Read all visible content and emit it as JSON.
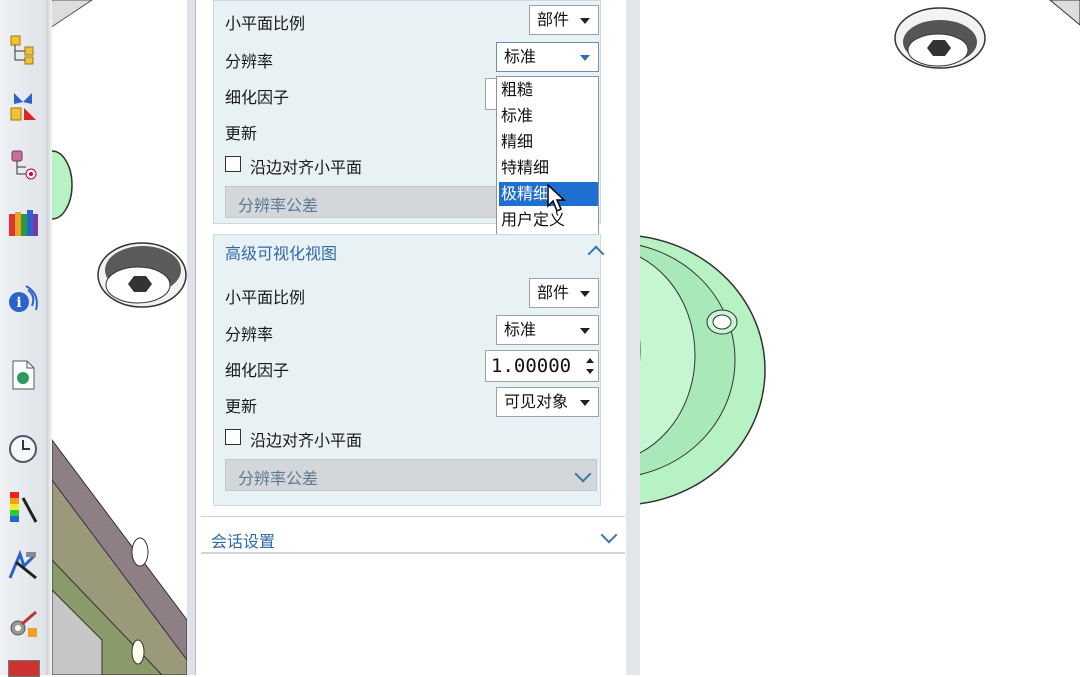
{
  "toolbar": {
    "icons": [
      "assembly-navigator-icon",
      "constraint-icon",
      "part-navigator-icon",
      "reuse-library-icon",
      "info-icon",
      "document-icon",
      "history-icon",
      "analysis-icon",
      "roles-icon",
      "process-icon"
    ]
  },
  "panel1": {
    "facet_label": "小平面比例",
    "facet_value": "部件",
    "resolution_label": "分辨率",
    "resolution_value": "标准",
    "refine_label": "细化因子",
    "update_label": "更新",
    "edge_align_label": "沿边对齐小平面",
    "tolerance_label": "分辨率公差"
  },
  "dropdown": {
    "options": [
      "粗糙",
      "标准",
      "精细",
      "特精细",
      "极精细",
      "用户定义"
    ],
    "selected_index": 4
  },
  "section_advanced": {
    "title": "高级可视化视图",
    "facet_label": "小平面比例",
    "facet_value": "部件",
    "resolution_label": "分辨率",
    "resolution_value": "标准",
    "refine_label": "细化因子",
    "refine_value": "1.00000",
    "update_label": "更新",
    "update_value": "可见对象",
    "edge_align_label": "沿边对齐小平面",
    "tolerance_label": "分辨率公差"
  },
  "section_session": {
    "title": "会话设置"
  },
  "colors": {
    "accent": "#2f6aa5",
    "selection": "#1f6fd0",
    "cad_green": "#b7f2c4"
  }
}
